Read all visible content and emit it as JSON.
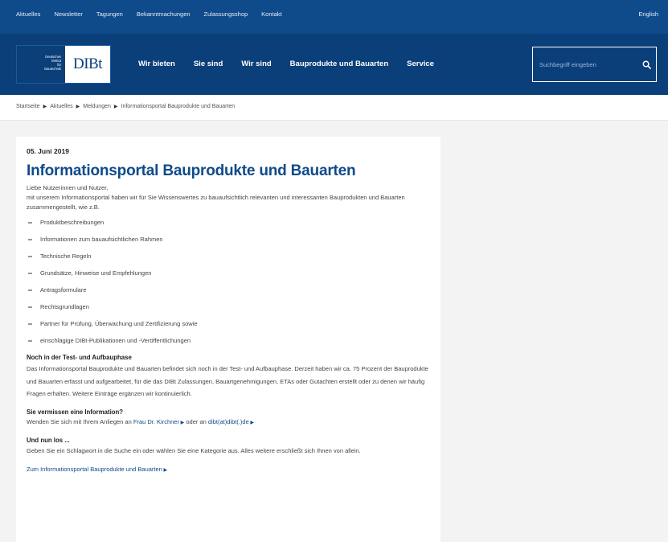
{
  "top_nav": {
    "items": [
      "Aktuelles",
      "Newsletter",
      "Tagungen",
      "Bekanntmachungen",
      "Zulassungsshop",
      "Kontakt"
    ],
    "lang": "English"
  },
  "logo": {
    "line1": "Deutsches",
    "line2": "Institut",
    "line3": "für",
    "line4": "Bautechnik",
    "wordmark": "DIBt"
  },
  "main_nav": {
    "items": [
      "Wir bieten",
      "Sie sind",
      "Wir sind",
      "Bauprodukte und Bauarten",
      "Service"
    ]
  },
  "search": {
    "placeholder": "Suchbegriff eingeben",
    "icon": "search-icon"
  },
  "breadcrumb": {
    "items": [
      "Startseite",
      "Aktuelles",
      "Meldungen",
      "Informationsportal Bauprodukte und Bauarten"
    ],
    "separator": "chevron-right-icon"
  },
  "article": {
    "date": "05. Juni 2019",
    "title": "Informationsportal Bauprodukte und Bauarten",
    "greeting": "Liebe Nutzerinnen und Nutzer,",
    "intro": "mit unserem Informationsportal haben wir für Sie Wissenswertes zu bauaufsichtlich relevanten und interessanten Bauprodukten und Bauarten zusammengestellt, wie z.B.",
    "features": [
      "Produktbeschreibungen",
      "Informationen zum bauaufsichtlichen Rahmen",
      "Technische Regeln",
      "Grundsätze, Hinweise und Empfehlungen",
      "Antragsformulare",
      "Rechtsgrundlagen",
      "Partner für Prüfung, Überwachung und Zertifizierung sowie",
      "einschlägige DIBt-Publikationen und -Veröffentlichungen"
    ],
    "section1": {
      "heading": "Noch in der Test- und Aufbauphase",
      "text": "Das Informationsportal Bauprodukte und Bauarten befindet sich noch in der Test- und Aufbauphase. Derzeit haben wir ca. 75 Prozent der Bauprodukte und Bauarten erfasst und aufgearbeitet, für die das DIBt Zulassungen, Bauartgenehmigungen, ETAs oder Gutachten erstellt oder zu denen wir häufig Fragen erhalten. Weitere Einträge ergänzen wir kontinuierlich."
    },
    "section2": {
      "heading": "Sie vermissen eine Information?",
      "text_before": "Wenden Sie sich mit Ihrem Anliegen an",
      "contact_link": "Frau Dr. Kirchner",
      "text_middle": "oder an",
      "email_link": "dibt(at)dibt(.)de"
    },
    "section3": {
      "heading": "Und nun los ...",
      "text": "Geben Sie ein Schlagwort in die Suche ein oder wählen Sie eine Kategorie aus. Alles weitere erschließt sich Ihnen von allein."
    },
    "portal_link": "Zum Informationsportal Bauprodukte und Bauarten"
  },
  "colors": {
    "topbar": "#0f4a8a",
    "mainbar": "#0a3f7a",
    "link": "#0f4a8a",
    "page_bg": "#f3f3f3"
  }
}
